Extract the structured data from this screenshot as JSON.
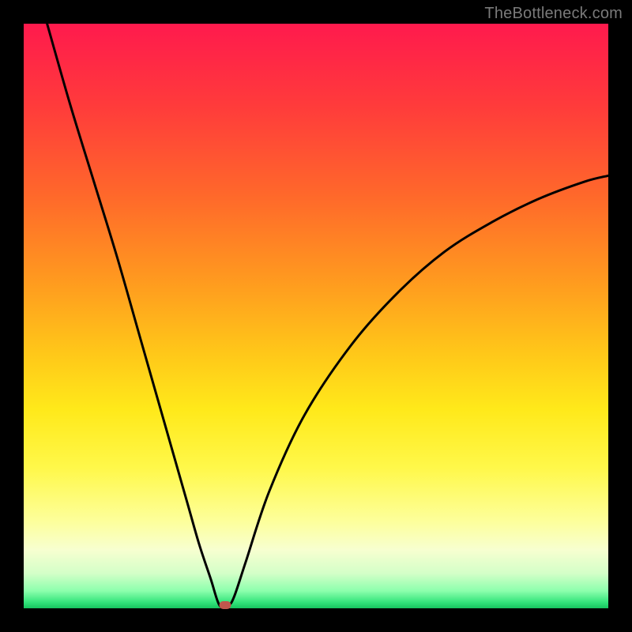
{
  "watermark": "TheBottleneck.com",
  "chart_data": {
    "type": "line",
    "title": "",
    "xlabel": "",
    "ylabel": "",
    "xlim": [
      0,
      100
    ],
    "ylim": [
      0,
      100
    ],
    "grid": false,
    "series": [
      {
        "name": "curve",
        "x": [
          4,
          8,
          12,
          16,
          20,
          24,
          28,
          30,
          32,
          33.5,
          35,
          36,
          38,
          42,
          48,
          56,
          64,
          72,
          80,
          88,
          96,
          100
        ],
        "y": [
          100,
          86,
          73,
          60,
          46,
          32,
          18,
          11,
          5,
          0.5,
          0.5,
          2,
          8,
          20,
          33,
          45,
          54,
          61,
          66,
          70,
          73,
          74
        ]
      }
    ],
    "marker": {
      "x": 34.5,
      "y": 0.5
    },
    "background_gradient": {
      "top": "#ff1a4d",
      "mid": "#ffe91a",
      "bottom": "#17c45f"
    },
    "curve_color": "#000000",
    "marker_color": "#c0574d"
  }
}
